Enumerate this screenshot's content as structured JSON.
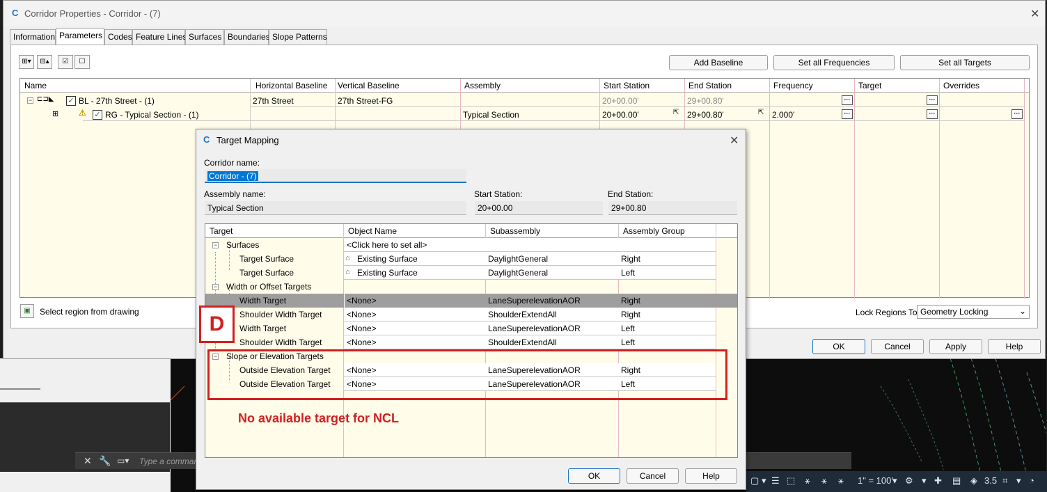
{
  "main_window": {
    "title": "Corridor Properties - Corridor - (7)",
    "tabs": [
      "Information",
      "Parameters",
      "Codes",
      "Feature Lines",
      "Surfaces",
      "Boundaries",
      "Slope Patterns"
    ],
    "active_tab": "Parameters",
    "buttons": {
      "add_baseline": "Add Baseline",
      "set_all_frequencies": "Set all Frequencies",
      "set_all_targets": "Set all Targets",
      "ok": "OK",
      "cancel": "Cancel",
      "apply": "Apply",
      "help": "Help"
    },
    "columns": [
      "Name",
      "Horizontal Baseline",
      "Vertical Baseline",
      "Assembly",
      "Start Station",
      "End Station",
      "Frequency",
      "Target",
      "Overrides"
    ],
    "rows": [
      {
        "name": "BL - 27th Street - (1)",
        "horizontal_baseline": "27th Street",
        "vertical_baseline": "27th Street-FG",
        "assembly": "",
        "start_station": "20+00.00'",
        "end_station": "29+00.80'",
        "frequency": "",
        "target": "",
        "overrides": ""
      },
      {
        "name": "RG - Typical Section - (1)",
        "horizontal_baseline": "",
        "vertical_baseline": "",
        "assembly": "Typical Section",
        "start_station": "20+00.00'",
        "end_station": "29+00.80'",
        "frequency": "2.000'",
        "target": "",
        "overrides": ""
      }
    ],
    "select_region_label": "Select region from drawing",
    "lock_regions_label": "Lock Regions To:",
    "lock_regions_value": "Geometry Locking"
  },
  "dialog": {
    "title": "Target Mapping",
    "corridor_name_label": "Corridor name:",
    "corridor_name": "Corridor - (7)",
    "assembly_name_label": "Assembly name:",
    "assembly_name": "Typical Section",
    "start_station_label": "Start Station:",
    "start_station": "20+00.00",
    "end_station_label": "End Station:",
    "end_station": "29+00.80",
    "columns": [
      "Target",
      "Object Name",
      "Subassembly",
      "Assembly Group"
    ],
    "rows": [
      {
        "kind": "group",
        "target": "Surfaces",
        "object": "<Click here to set all>",
        "subassembly": "",
        "group": ""
      },
      {
        "kind": "item",
        "target": "Target Surface",
        "object": "Existing Surface",
        "surface_icon": true,
        "subassembly": "DaylightGeneral",
        "group": "Right"
      },
      {
        "kind": "item",
        "target": "Target Surface",
        "object": "Existing Surface",
        "surface_icon": true,
        "subassembly": "DaylightGeneral",
        "group": "Left"
      },
      {
        "kind": "group",
        "target": "Width or Offset Targets",
        "object": "",
        "subassembly": "",
        "group": ""
      },
      {
        "kind": "item",
        "target": "Width Target",
        "object": "<None>",
        "subassembly": "LaneSuperelevationAOR",
        "group": "Right",
        "selected": true
      },
      {
        "kind": "item",
        "target": "Shoulder Width Target",
        "object": "<None>",
        "subassembly": "ShoulderExtendAll",
        "group": "Right"
      },
      {
        "kind": "item",
        "target": "Width Target",
        "object": "<None>",
        "subassembly": "LaneSuperelevationAOR",
        "group": "Left"
      },
      {
        "kind": "item",
        "target": "Shoulder Width Target",
        "object": "<None>",
        "subassembly": "ShoulderExtendAll",
        "group": "Left"
      },
      {
        "kind": "group",
        "target": "Slope or Elevation Targets",
        "object": "",
        "subassembly": "",
        "group": ""
      },
      {
        "kind": "item",
        "target": "Outside Elevation Target",
        "object": "<None>",
        "subassembly": "LaneSuperelevationAOR",
        "group": "Right"
      },
      {
        "kind": "item",
        "target": "Outside Elevation Target",
        "object": "<None>",
        "subassembly": "LaneSuperelevationAOR",
        "group": "Left"
      }
    ],
    "buttons": {
      "ok": "OK",
      "cancel": "Cancel",
      "help": "Help"
    }
  },
  "annotations": {
    "label_d": "D",
    "note": "No available target for NCL",
    "color": "#d21f1f"
  },
  "background": {
    "command_placeholder": "Type a command",
    "scale": "1\" = 100'",
    "lineweight": "3.5"
  }
}
